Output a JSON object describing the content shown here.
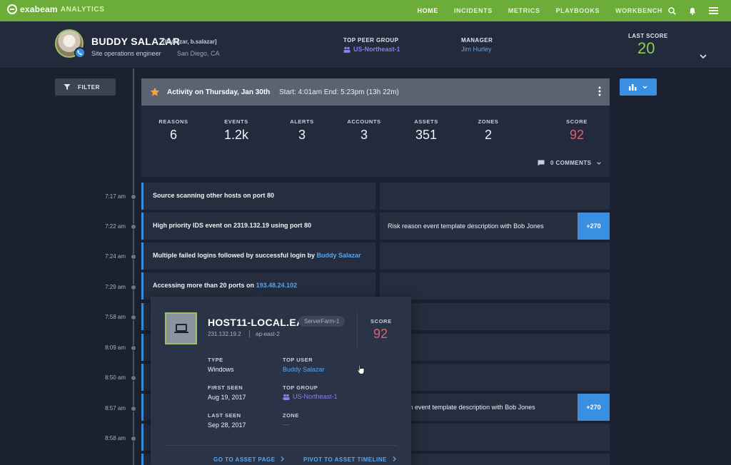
{
  "nav": {
    "brand": "exabeam",
    "brand_sub": "ANALYTICS",
    "items": [
      "HOME",
      "INCIDENTS",
      "METRICS",
      "PLAYBOOKS",
      "WORKBENCH"
    ],
    "active": "HOME",
    "icons": [
      "search-icon",
      "bell-icon",
      "menu-icon"
    ],
    "colors": {
      "bar": "#6cad3a"
    }
  },
  "user": {
    "name": "BUDDY SALAZAR",
    "handles": "[bsalazar, b.salazar]",
    "role": "Site operations engineer",
    "location": "San Diego, CA",
    "peer_group_label": "TOP PEER GROUP",
    "peer_group": "US-Northeast-1",
    "manager_label": "MANAGER",
    "manager": "Jim Hurley",
    "last_score_label": "LAST SCORE",
    "last_score": "20"
  },
  "filter": {
    "label": "FILTER"
  },
  "activity": {
    "title": "Activity on Thursday, Jan 30th",
    "times": "Start: 4:01am End: 5:23pm (13h 22m)",
    "stats": [
      {
        "label": "REASONS",
        "value": "6"
      },
      {
        "label": "EVENTS",
        "value": "1.2k"
      },
      {
        "label": "ALERTS",
        "value": "3"
      },
      {
        "label": "ACCOUNTS",
        "value": "3"
      },
      {
        "label": "ASSETS",
        "value": "351"
      },
      {
        "label": "ZONES",
        "value": "2"
      },
      {
        "label": "SCORE",
        "value": "92"
      }
    ],
    "comments": "0 COMMENTS"
  },
  "timeline": {
    "times": [
      "7:17 am",
      "7:22 am",
      "7:24 am",
      "7:29 am",
      "7:58 am",
      "8:09 am",
      "8:50 am",
      "8:57 am",
      "8:58 am"
    ],
    "events": [
      {
        "text": "Source scanning other hosts on port 80",
        "link": ""
      },
      {
        "text": "High priority IDS event on 2319.132.19 using port 80",
        "link": ""
      },
      {
        "text": "Multiple failed logins followed by successful login by",
        "link": "Buddy Salazar"
      },
      {
        "text": "Accessing more than 20 ports on",
        "link": "193.48.24.102"
      }
    ],
    "reason_1": {
      "text": "Risk reason event template description with Bob Jones",
      "badge": "+270"
    },
    "reason_2": {
      "text": "son event template description with Bob Jones",
      "badge": "+270"
    }
  },
  "asset_popover": {
    "host": "HOST11-LOCAL.EAST",
    "tag": "ServerFarm-1",
    "ip": "231.132.19.2",
    "region": "ap-east-2",
    "score_label": "SCORE",
    "score": "92",
    "type_label": "TYPE",
    "type": "Windows",
    "top_user_label": "TOP USER",
    "top_user": "Buddy Salazar",
    "first_seen_label": "FIRST SEEN",
    "first_seen": "Aug 19, 2017",
    "top_group_label": "TOP GROUP",
    "top_group": "US-Northeast-1",
    "last_seen_label": "LAST SEEN",
    "last_seen": "Sep 28, 2017",
    "zone_label": "ZONE",
    "zone": "—",
    "action_asset": "GO TO ASSET PAGE",
    "action_timeline": "PIVOT TO ASSET TIMELINE"
  }
}
